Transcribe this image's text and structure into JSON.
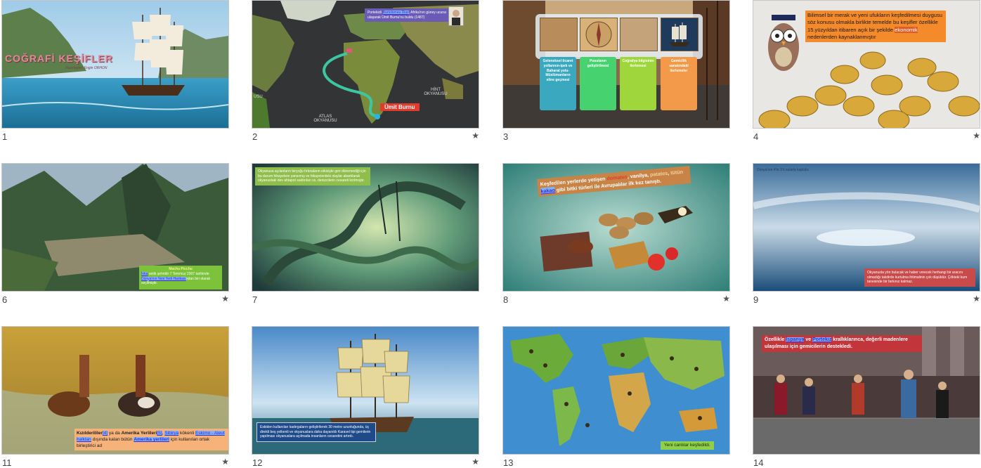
{
  "slides": [
    {
      "num": "1",
      "title": "COĞRAFİ KEŞİFLER",
      "author": "Hazırlayan: Engin ORHON",
      "starred": false
    },
    {
      "num": "2",
      "starred": true,
      "caption_pre": "Portekizli",
      "caption_link": "Bartolomeu Dias",
      "caption_post": ", Afrika'nın güney ucuna ulaşarak Ümit Burnu'nu buldu (1487)",
      "label_cape": "Ümit Burnu",
      "label_indian": "HİNT OKYANUSU",
      "label_atlantic": "ATLAS OKYANUSU",
      "label_usu": "USU"
    },
    {
      "num": "3",
      "starred": false,
      "cards": [
        {
          "text": "Geleneksel ticaret yollarının-ipek ve Baharat yolu-Müslümanların eline geçmesi",
          "color": "#3aa9c0"
        },
        {
          "text": "Pusulanın geliştirilmesi",
          "color": "#46d36f"
        },
        {
          "text": "Coğrafya bilgisinin ilerlemesi",
          "color": "#9ed63c"
        },
        {
          "text": "Gemicilik sanatındaki ilerlemeler",
          "color": "#f29a4a"
        }
      ]
    },
    {
      "num": "4",
      "starred": true,
      "text_pre": "Bilimsel bir merak ve yeni ufukların keşfedilmesi duygusu söz konusu olmakla birlikte temelde bu keşifler özellikle 15.yüzyıldan itibaren açık bir şekilde",
      "text_link": "ekonomik",
      "text_post": "nedenlerden kaynaklanmıştır"
    },
    {
      "num": "6",
      "starred": true,
      "box_title": "Machu Picchu",
      "box_text_1": "İnka",
      "box_text_2": " antik şehridir",
      "box_text_3": " 7 Temmuz 2007 tarihinde",
      "box_link": "Dünya'nın Yeni Yedi Harikası",
      "box_text_4": "ndan biri olarak seçilmiştir."
    },
    {
      "num": "7",
      "starred": false,
      "text": "Okyanusa açılanların birçoğu fırtınaların etkisiyle geri dönemediği için bu durum hikayelere yansımış ve hikayelerdeki olaylar abartılarak okyanustaki dev ahtapot saldırıları vs. denizcilerin cesareti kırılmıştır."
    },
    {
      "num": "8",
      "starred": true,
      "t1": "Keşfedilen yerlerde yetişen ",
      "w_domates": "domates",
      "t2": ", vanilya, ",
      "w_patates": "patates",
      "t3": ", ",
      "w_tutun": "tütün",
      "t4": " ",
      "w_kakao": "kakao",
      "t5": " gibi bitki türleri ile Avrupalılar ilk kez tanıştı."
    },
    {
      "num": "9",
      "starred": true,
      "top_text": "Dünya'nın 4'te 3'ü sularla kaplıdır.",
      "bottom_text": "Okyanusta yön bulacak ve haber verecek herhangi bir aracını olmadığı takdirde kurtulma ihtimalinin çok düşüktür. Çökteki kum tanesinde bir farkınız kalmaz."
    },
    {
      "num": "11",
      "starred": true,
      "b1": "Kızılderililer",
      "l1": "[4]",
      "m1": " ya da ",
      "b2": "Amerika Yerlileri",
      "l2": "[5]",
      "m2": ", ",
      "l3": "Sibirya",
      "m3": " kökenli ",
      "l4": "Eskimo - Aleut halkları",
      "m4": " dışında kalan bütün ",
      "l5": "Amerika yerlileri",
      "m5": " için kullanılan ortak birleştirici ad"
    },
    {
      "num": "12",
      "starred": true,
      "text": "Eskiden kullanılan kadırgaların geliştirilerek 30 metre uzunluğunda, üç direkli beş yelkenli ve okyanuslara daha dayanıklı Karavel tipi gemilerin yapılması okyanuslara açılmada insanların cesaretini artırdı."
    },
    {
      "num": "13",
      "starred": false,
      "text": "Yeni canlılar keşfedildi."
    },
    {
      "num": "14",
      "starred": false,
      "t1": "Özellikle ",
      "l1": "İspanya",
      "t2": " ve ",
      "l2": "Portekiz",
      "t3": " krallıklarınca, değerli madenlere ulaşılması için gemicilerin destekledi."
    }
  ],
  "star_glyph": "★",
  "colors": {
    "accent_link": "#3a2bd1",
    "thumb_border": "#c8c8c8"
  }
}
